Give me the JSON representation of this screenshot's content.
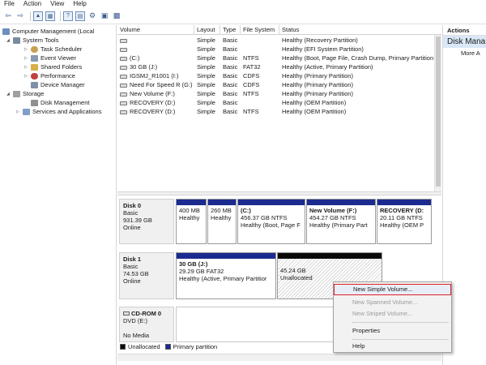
{
  "menu": [
    "File",
    "Action",
    "View",
    "Help"
  ],
  "tree": {
    "root": "Computer Management (Local",
    "system_tools": "System Tools",
    "task_scheduler": "Task Scheduler",
    "event_viewer": "Event Viewer",
    "shared_folders": "Shared Folders",
    "performance": "Performance",
    "device_manager": "Device Manager",
    "storage": "Storage",
    "disk_management": "Disk Management",
    "services": "Services and Applications"
  },
  "volumes": {
    "headers": [
      "Volume",
      "Layout",
      "Type",
      "File System",
      "Status"
    ],
    "rows": [
      {
        "volume": "",
        "layout": "Simple",
        "type": "Basic",
        "fs": "",
        "status": "Healthy (Recovery Partition)"
      },
      {
        "volume": "",
        "layout": "Simple",
        "type": "Basic",
        "fs": "",
        "status": "Healthy (EFI System Partition)"
      },
      {
        "volume": "(C:)",
        "layout": "Simple",
        "type": "Basic",
        "fs": "NTFS",
        "status": "Healthy (Boot, Page File, Crash Dump, Primary Partition"
      },
      {
        "volume": "30 GB (J:)",
        "layout": "Simple",
        "type": "Basic",
        "fs": "FAT32",
        "status": "Healthy (Active, Primary Partition)"
      },
      {
        "volume": "IGSMJ_R1001 (I:)",
        "layout": "Simple",
        "type": "Basic",
        "fs": "CDFS",
        "status": "Healthy (Primary Partition)"
      },
      {
        "volume": "Need For Speed R (G:)",
        "layout": "Simple",
        "type": "Basic",
        "fs": "CDFS",
        "status": "Healthy (Primary Partition)"
      },
      {
        "volume": "New Volume (F:)",
        "layout": "Simple",
        "type": "Basic",
        "fs": "NTFS",
        "status": "Healthy (Primary Partition)"
      },
      {
        "volume": "RECOVERY (D:)",
        "layout": "Simple",
        "type": "Basic",
        "fs": "",
        "status": "Healthy (OEM Partition)"
      },
      {
        "volume": "RECOVERY (D:)",
        "layout": "Simple",
        "type": "Basic",
        "fs": "NTFS",
        "status": "Healthy (OEM Partition)"
      }
    ]
  },
  "disks": {
    "disk0": {
      "name": "Disk 0",
      "type": "Basic",
      "size": "931.39 GB",
      "state": "Online",
      "parts": [
        {
          "title": "",
          "l1": "400 MB",
          "l2": "Healthy"
        },
        {
          "title": "",
          "l1": "260 MB",
          "l2": "Healthy"
        },
        {
          "title": "(C:)",
          "l1": "456.37 GB NTFS",
          "l2": "Healthy (Boot, Page F"
        },
        {
          "title": "New Volume  (F:)",
          "l1": "454.27 GB NTFS",
          "l2": "Healthy (Primary Part"
        },
        {
          "title": "RECOVERY  (D:",
          "l1": "20.11 GB NTFS",
          "l2": "Healthy (OEM P"
        }
      ]
    },
    "disk1": {
      "name": "Disk 1",
      "type": "Basic",
      "size": "74.53 GB",
      "state": "Online",
      "parts": [
        {
          "title": "30 GB  (J:)",
          "l1": "29.29 GB FAT32",
          "l2": "Healthy (Active, Primary Partitior"
        },
        {
          "title": "",
          "l1": "45.24 GB",
          "l2": "Unallocated"
        }
      ]
    },
    "cdrom0": {
      "name": "CD-ROM 0",
      "type": "DVD (E:)",
      "state": "No Media"
    }
  },
  "legend": {
    "unallocated": "Unallocated",
    "primary": "Primary partition"
  },
  "actions": {
    "header": "Actions",
    "selected": "Disk Mana",
    "more": "More A"
  },
  "context_menu": {
    "new_simple": "New Simple Volume...",
    "new_spanned": "New Spanned Volume...",
    "new_striped": "New Striped Volume...",
    "properties": "Properties",
    "help": "Help"
  },
  "colors": {
    "primary_partition": "#1c2b8f",
    "unallocated": "#0a0a0a",
    "highlight_border": "#e0202a"
  }
}
